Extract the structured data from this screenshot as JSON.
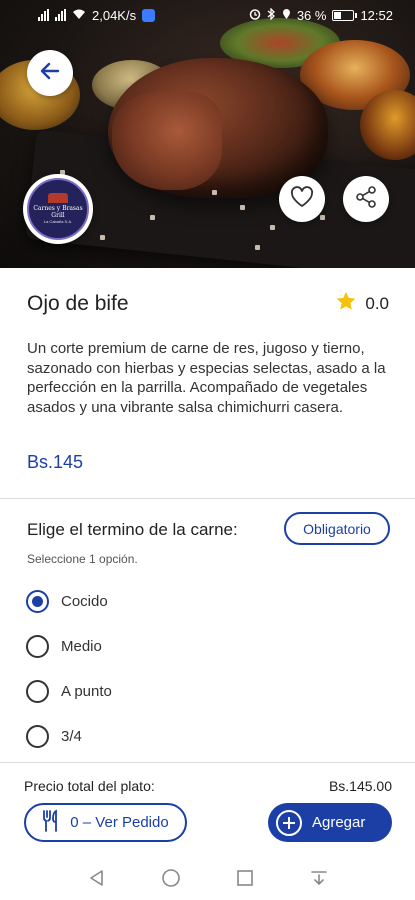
{
  "status_bar": {
    "speed": "2,04K/s",
    "battery": "36 %",
    "time": "12:52"
  },
  "restaurant": {
    "logo_line1": "Carnes y Brasas",
    "logo_line2": "Grill",
    "logo_line3": "La Cabaña S.A."
  },
  "dish": {
    "name": "Ojo de bife",
    "rating": "0.0",
    "description": "Un corte premium de carne de res, jugoso y tierno, sazonado con hierbas y especias selectas, asado a la perfección en la parrilla. Acompañado de vegetales asados y una vibrante salsa chimichurri casera.",
    "price": "Bs.145"
  },
  "options": {
    "title": "Elige el termino de la carne:",
    "badge": "Obligatorio",
    "hint": "Seleccione 1 opción.",
    "choices": [
      {
        "label": "Cocido",
        "selected": true
      },
      {
        "label": "Medio",
        "selected": false
      },
      {
        "label": "A punto",
        "selected": false
      },
      {
        "label": "3/4",
        "selected": false
      }
    ]
  },
  "footer": {
    "total_label": "Precio total del plato:",
    "total_value": "Bs.145.00",
    "order_button": "0 – Ver Pedido",
    "add_button": "Agregar"
  },
  "colors": {
    "accent": "#1c3fa5",
    "star": "#f4c20d"
  },
  "icons": [
    "back-arrow-icon",
    "heart-icon",
    "share-icon",
    "star-icon",
    "cutlery-icon",
    "plus-icon"
  ]
}
